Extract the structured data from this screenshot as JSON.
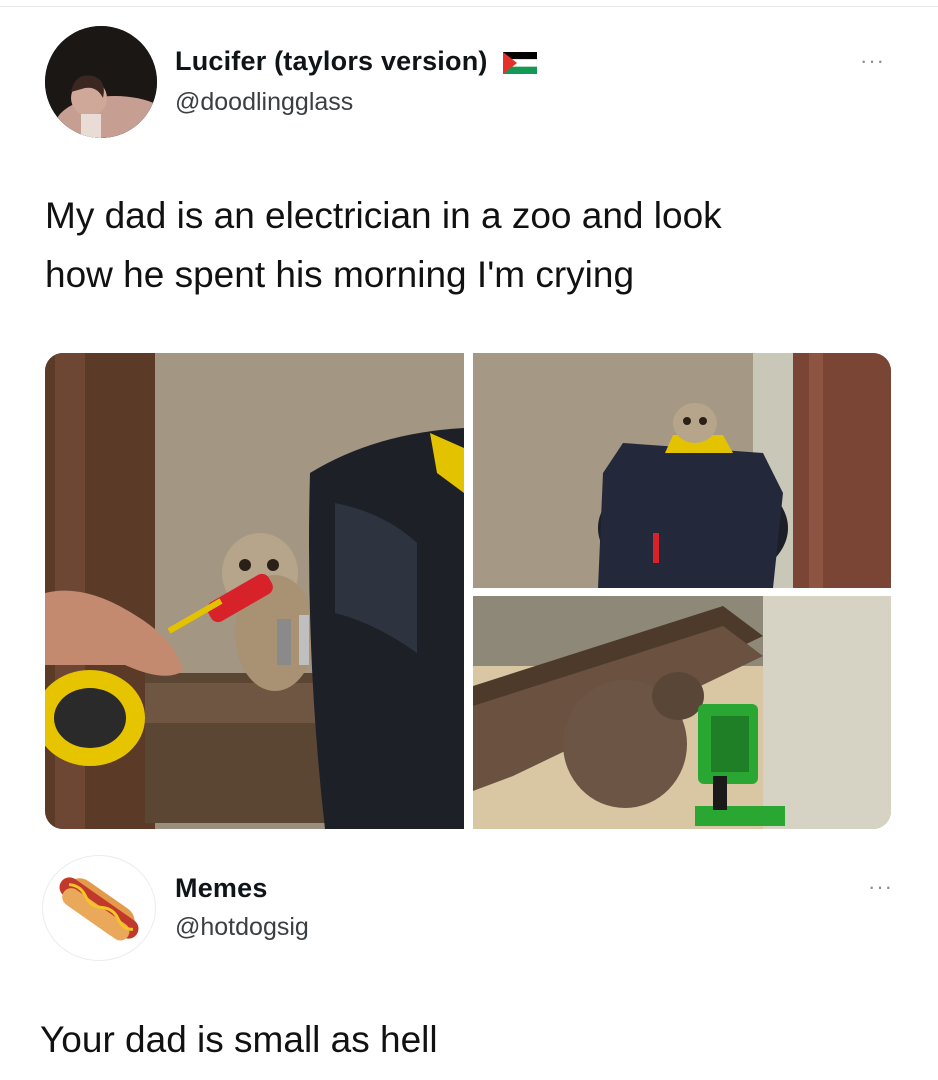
{
  "tweet": {
    "author_name": "Lucifer (taylors version)",
    "author_handle": "@doodlingglass",
    "author_flag_icon": "palestine-flag-icon",
    "text_line1": "My dad is an electrician in a zoo and look",
    "text_line2": "how he spent his morning I'm crying",
    "more_label": "···",
    "photos": [
      {
        "name": "meerkat-with-screwdriver-photo"
      },
      {
        "name": "meerkat-in-tool-bag-photo"
      },
      {
        "name": "meerkat-with-work-light-photo"
      }
    ]
  },
  "reply": {
    "author_name": "Memes",
    "author_handle": "@hotdogsig",
    "avatar_icon": "hotdog-icon",
    "more_label": "···",
    "text": "Your dad is small as hell"
  },
  "colors": {
    "text": "#0f1419",
    "secondary": "#3a3f44",
    "divider": "#e6e6e6"
  }
}
